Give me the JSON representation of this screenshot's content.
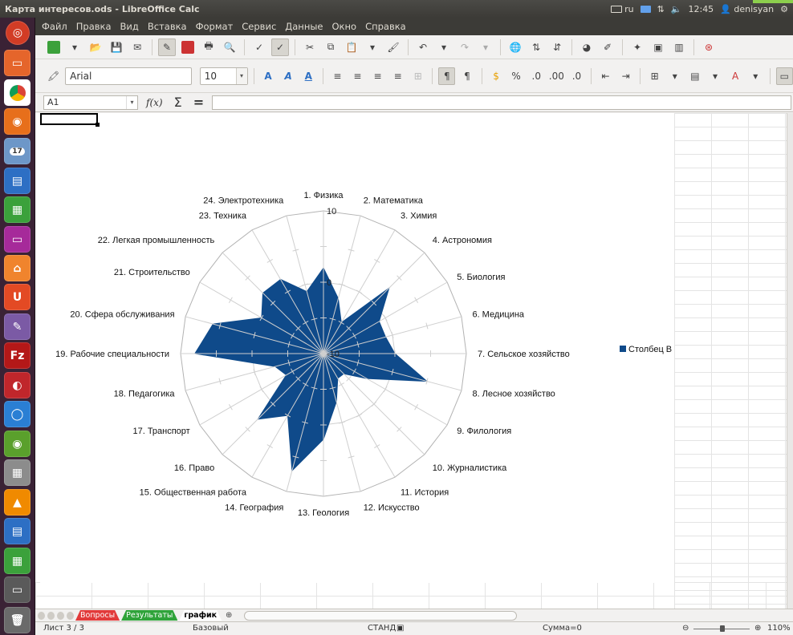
{
  "window": {
    "title": "Карта интересов.ods - LibreOffice Calc"
  },
  "tray": {
    "lang": "ru",
    "time": "12:45",
    "user": "denisyan"
  },
  "launcher": {
    "badge": "17"
  },
  "menu": [
    "Файл",
    "Правка",
    "Вид",
    "Вставка",
    "Формат",
    "Сервис",
    "Данные",
    "Окно",
    "Справка"
  ],
  "formatting": {
    "font_name": "Arial",
    "font_size": "10"
  },
  "formula": {
    "cell_ref": "A1",
    "fx": "f(x)",
    "sigma": "Σ",
    "equals": "="
  },
  "chart_data": {
    "type": "radar",
    "categories": [
      "1. Физика",
      "2. Математика",
      "3. Химия",
      "4. Астрономия",
      "5. Биология",
      "6. Медицина",
      "7. Сельское хозяйство",
      "8. Лесное хозяйство",
      "9. Филология",
      "10. Журналистика",
      "11. История",
      "12. Искусство",
      "13. Геология",
      "14. География",
      "15. Общественная работа",
      "16. Право",
      "17. Транспорт",
      "18. Педагогика",
      "19. Рабочие специальности",
      "20. Сфера обслуживания",
      "21. Строительство",
      "22. Легкая промышленность",
      "23. Техника",
      "24. Электротехника"
    ],
    "series": [
      {
        "name": "Столбец B",
        "color": "#0f4a8a",
        "values": [
          2,
          -2,
          -5,
          3,
          -1,
          -1,
          0,
          5,
          -3,
          -6,
          -6,
          -3,
          2,
          7,
          0,
          3,
          -4,
          -3,
          8,
          6,
          0,
          2,
          2,
          -1
        ]
      }
    ],
    "axis_ticks": [
      "10",
      "0",
      "-10"
    ],
    "ylim": [
      -10,
      10
    ],
    "legend_position": "right",
    "grid": true
  },
  "sheets": {
    "tabs": [
      "Вопросы",
      "Результаты",
      "график"
    ],
    "colors": [
      "#e23a3a",
      "#2fa33a",
      "#ffffff"
    ]
  },
  "status": {
    "sheet": "Лист 3 / 3",
    "style": "Базовый",
    "mode": "СТАНД",
    "sum": "Сумма=0",
    "zoom": "110%"
  }
}
